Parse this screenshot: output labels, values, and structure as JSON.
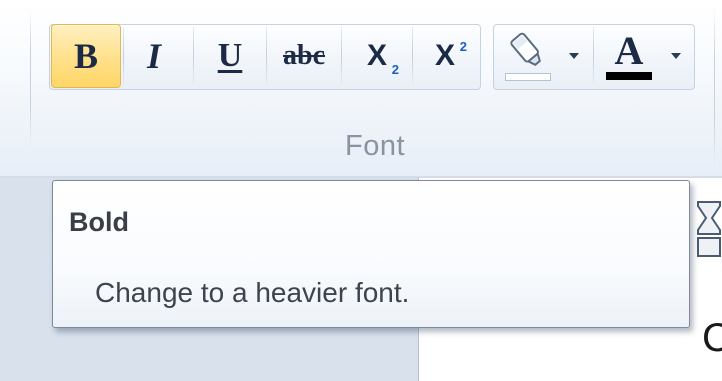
{
  "ribbon": {
    "group_label": "Font",
    "buttons": {
      "bold": "B",
      "italic": "I",
      "underline": "U",
      "strikethrough": "abc",
      "subscript_base": "X",
      "subscript_mark": "2",
      "superscript_base": "X",
      "superscript_mark": "2",
      "font_color": "A"
    },
    "active_button": "bold",
    "font_color_value": "#000000",
    "highlight_color_value": "#ffffff"
  },
  "tooltip": {
    "title": "Bold",
    "description": "Change to a heavier font."
  },
  "document": {
    "visible_letter": "C"
  },
  "icons": [
    "bold-icon",
    "italic-icon",
    "underline-icon",
    "strikethrough-icon",
    "subscript-icon",
    "superscript-icon",
    "highlighter-icon",
    "font-color-icon",
    "dropdown-caret-icon"
  ]
}
